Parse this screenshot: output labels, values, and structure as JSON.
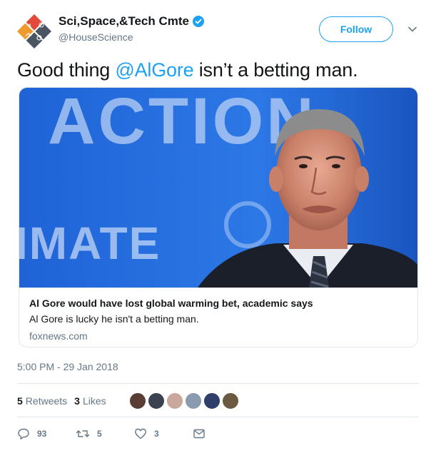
{
  "account": {
    "display_name": "Sci,Space,&Tech Cmte",
    "handle": "@HouseScience",
    "verified": true
  },
  "follow_label": "Follow",
  "tweet": {
    "text_before": "Good thing ",
    "mention": "@AlGore",
    "text_after": " isn’t a betting man."
  },
  "card": {
    "image_text_top": "ACTION",
    "image_text_bottom": "IMATE",
    "title": "Al Gore would have lost global warming bet, academic says",
    "description": "Al Gore is lucky he isn't a betting man.",
    "domain": "foxnews.com"
  },
  "timestamp": "5:00 PM - 29 Jan 2018",
  "stats": {
    "retweets_count": "5",
    "retweets_label": "Retweets",
    "likes_count": "3",
    "likes_label": "Likes",
    "liker_colors": [
      "#5a3e36",
      "#3b4250",
      "#c9a79a",
      "#8a9bb0",
      "#2f3f6a",
      "#6b5a42"
    ]
  },
  "actions": {
    "replies": "93",
    "retweets": "5",
    "likes": "3"
  },
  "colors": {
    "accent": "#1da1f2",
    "secondary_text": "#657786",
    "border": "#e1e8ed"
  }
}
